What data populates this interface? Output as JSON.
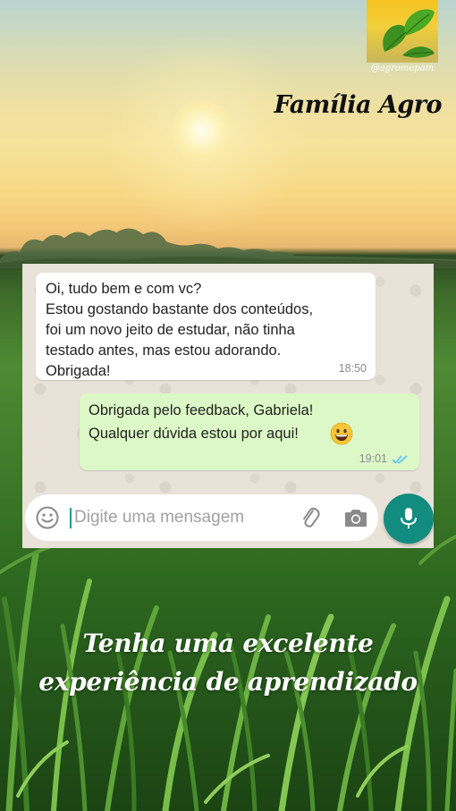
{
  "brand": {
    "logo_handle": "@agromapam",
    "title": "Família Agro"
  },
  "chat": {
    "messages": [
      {
        "direction": "incoming",
        "text": "Oi, tudo bem e com vc?\nEstou gostando bastante dos conteúdos,\nfoi um novo jeito de estudar, não tinha\ntestado antes, mas estou adorando.\nObrigada!",
        "time": "18:50"
      },
      {
        "direction": "outgoing",
        "text": "Obrigada pelo feedback, Gabriela!\nQualquer dúvida estou por aqui!",
        "emoji": "grinning-face",
        "time": "19:01",
        "status": "read"
      }
    ],
    "input": {
      "placeholder": "Digite uma mensagem",
      "value": ""
    }
  },
  "tagline": {
    "line1": "Tenha uma excelente",
    "line2": "experiência de aprendizado"
  },
  "colors": {
    "incoming_bubble": "#ffffff",
    "outgoing_bubble": "#dcf8c6",
    "read_ticks": "#4fc3f7",
    "mic_button": "#128c7e",
    "caret": "#1aa086",
    "logo_yellow": "#f6c21f"
  },
  "icons": {
    "emoji_button": "smile-icon",
    "attach": "paperclip-icon",
    "camera": "camera-icon",
    "send_voice": "microphone-icon",
    "ticks": "double-check-icon",
    "logo": "leaf-logo"
  }
}
